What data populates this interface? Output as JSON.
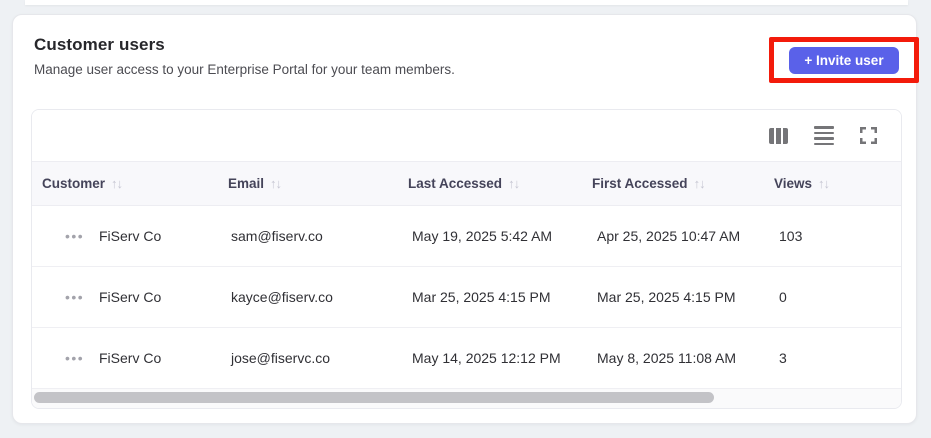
{
  "page": {
    "title": "Customer users",
    "subtitle": "Manage user access to your Enterprise Portal for your team members."
  },
  "invite_button": {
    "label": "+ Invite user"
  },
  "toolbar_icons": [
    {
      "name": "columns-icon"
    },
    {
      "name": "density-icon"
    },
    {
      "name": "fullscreen-icon"
    }
  ],
  "icons": {
    "sort": "↑↓",
    "row_menu": "•••"
  },
  "colors": {
    "accent": "#5a61e9",
    "highlight_box": "#f31b0b",
    "header_bg": "#f8f8fb"
  },
  "table": {
    "columns": [
      {
        "key": "customer",
        "label": "Customer"
      },
      {
        "key": "email",
        "label": "Email"
      },
      {
        "key": "last_accessed",
        "label": "Last Accessed"
      },
      {
        "key": "first_accessed",
        "label": "First Accessed"
      },
      {
        "key": "views",
        "label": "Views"
      }
    ],
    "rows": [
      {
        "customer": "FiServ Co",
        "email": "sam@fiserv.co",
        "last_accessed": "May 19, 2025 5:42 AM",
        "first_accessed": "Apr 25, 2025 10:47 AM",
        "views": "103"
      },
      {
        "customer": "FiServ Co",
        "email": "kayce@fiserv.co",
        "last_accessed": "Mar 25, 2025 4:15 PM",
        "first_accessed": "Mar 25, 2025 4:15 PM",
        "views": "0"
      },
      {
        "customer": "FiServ Co",
        "email": "jose@fiservc.co",
        "last_accessed": "May 14, 2025 12:12 PM",
        "first_accessed": "May 8, 2025 11:08 AM",
        "views": "3"
      }
    ]
  }
}
